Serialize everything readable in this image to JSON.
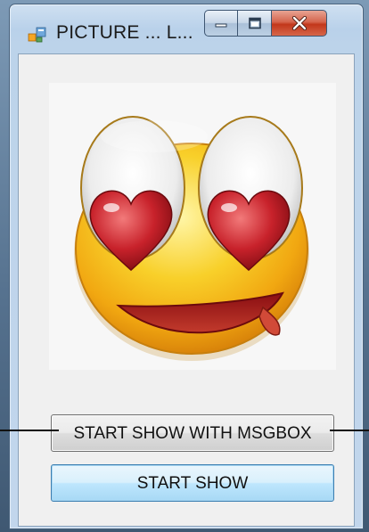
{
  "window": {
    "title": "PICTURE ... L...",
    "caption_buttons": {
      "minimize_icon": "minimize-icon",
      "maximize_icon": "maximize-icon",
      "close_icon": "close-icon"
    }
  },
  "picture": {
    "icon": "love-emoji-icon"
  },
  "buttons": {
    "start_show_msgbox": "START SHOW WITH MSGBOX",
    "start_show": "START SHOW"
  },
  "colors": {
    "close_button": "#c2371b",
    "focused_button_border": "#3c7fb1",
    "emoji_yellow": "#f6c61b",
    "heart_red": "#c8222b"
  }
}
